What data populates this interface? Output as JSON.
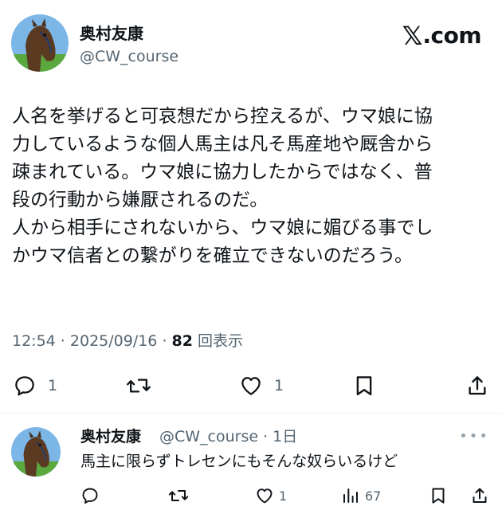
{
  "post": {
    "author": {
      "display_name": "奥村友康",
      "handle": "@CW_course"
    },
    "brand": {
      "x_glyph": "𝕏",
      "suffix": ".com"
    },
    "lines": [
      "人名を挙げると可哀想だから控えるが、ウマ娘に協",
      "力しているような個人馬主は凡そ馬産地や厩舎から",
      "疎まれている。ウマ娘に協力したからではなく、普",
      "段の行動から嫌厭されるのだ。",
      "人から相手にされないから、ウマ娘に媚びる事でし",
      "かウマ信者との繋がりを確立できないのだろう。"
    ],
    "meta": {
      "time": "12:54",
      "sep": " · ",
      "date": "2025/09/16",
      "views_count": "82",
      "views_label": "回表示"
    },
    "actions": {
      "reply_count": "1",
      "like_count": "1"
    }
  },
  "reply": {
    "display_name": "奥村友康",
    "handle_time": "@CW_course · 1日",
    "more": "•••",
    "text": "馬主に限らずトレセンにもそんな奴らいるけど",
    "actions": {
      "reply_count": "",
      "like_count": "1",
      "views_count": "67"
    }
  },
  "colors": {
    "text": "#0f1419",
    "secondary": "#536471",
    "divider": "#eff3f4"
  }
}
